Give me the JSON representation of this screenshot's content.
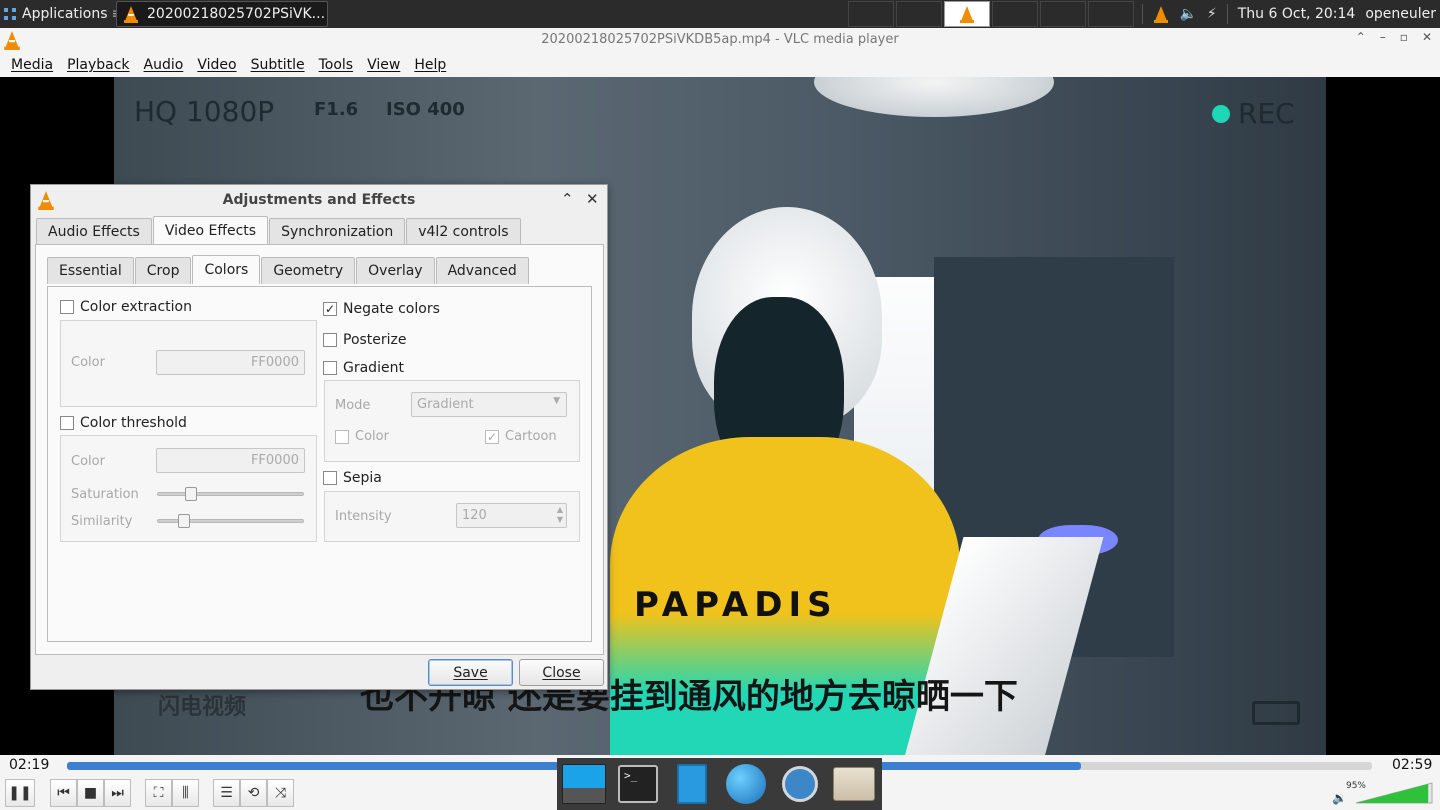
{
  "top_panel": {
    "apps_label": "Applications",
    "task_label": "20200218025702PSiVK...",
    "clock": "Thu  6 Oct, 20:14",
    "user": "openeuler"
  },
  "vlc": {
    "title": "20200218025702PSiVKDB5ap.mp4 - VLC media player",
    "menu": [
      "Media",
      "Playback",
      "Audio",
      "Video",
      "Subtitle",
      "Tools",
      "View",
      "Help"
    ]
  },
  "video_overlay": {
    "top_left": "HQ 1080P",
    "f_stop": "F1.6",
    "iso": "ISO 400",
    "rec": "REC",
    "shirt_text": "PAPADIS",
    "subtitle": "也不开晾 还是要挂到通风的地方去晾晒一下",
    "watermark": "闪电视频"
  },
  "dialog": {
    "title": "Adjustments and Effects",
    "main_tabs": [
      "Audio Effects",
      "Video Effects",
      "Synchronization",
      "v4l2 controls"
    ],
    "active_main_tab": 1,
    "sub_tabs": [
      "Essential",
      "Crop",
      "Colors",
      "Geometry",
      "Overlay",
      "Advanced"
    ],
    "active_sub_tab": 2,
    "color_extraction": {
      "label": "Color extraction",
      "checked": false,
      "color_label": "Color",
      "color_value": "FF0000"
    },
    "color_threshold": {
      "label": "Color threshold",
      "checked": false,
      "color_label": "Color",
      "color_value": "FF0000",
      "saturation_label": "Saturation",
      "similarity_label": "Similarity"
    },
    "negate": {
      "label": "Negate colors",
      "checked": true
    },
    "posterize": {
      "label": "Posterize",
      "checked": false
    },
    "gradient": {
      "label": "Gradient",
      "checked": false,
      "mode_label": "Mode",
      "mode_value": "Gradient",
      "color_label": "Color",
      "cartoon_label": "Cartoon"
    },
    "sepia": {
      "label": "Sepia",
      "checked": false,
      "intensity_label": "Intensity",
      "intensity_value": "120"
    },
    "save_label": "Save",
    "close_label": "Close"
  },
  "controls": {
    "elapsed": "02:19",
    "total": "02:59",
    "progress": 0.777,
    "volume_pct": "95%"
  },
  "colors": {
    "accent": "#3c7fd0",
    "vlc_orange": "#f08c00"
  }
}
